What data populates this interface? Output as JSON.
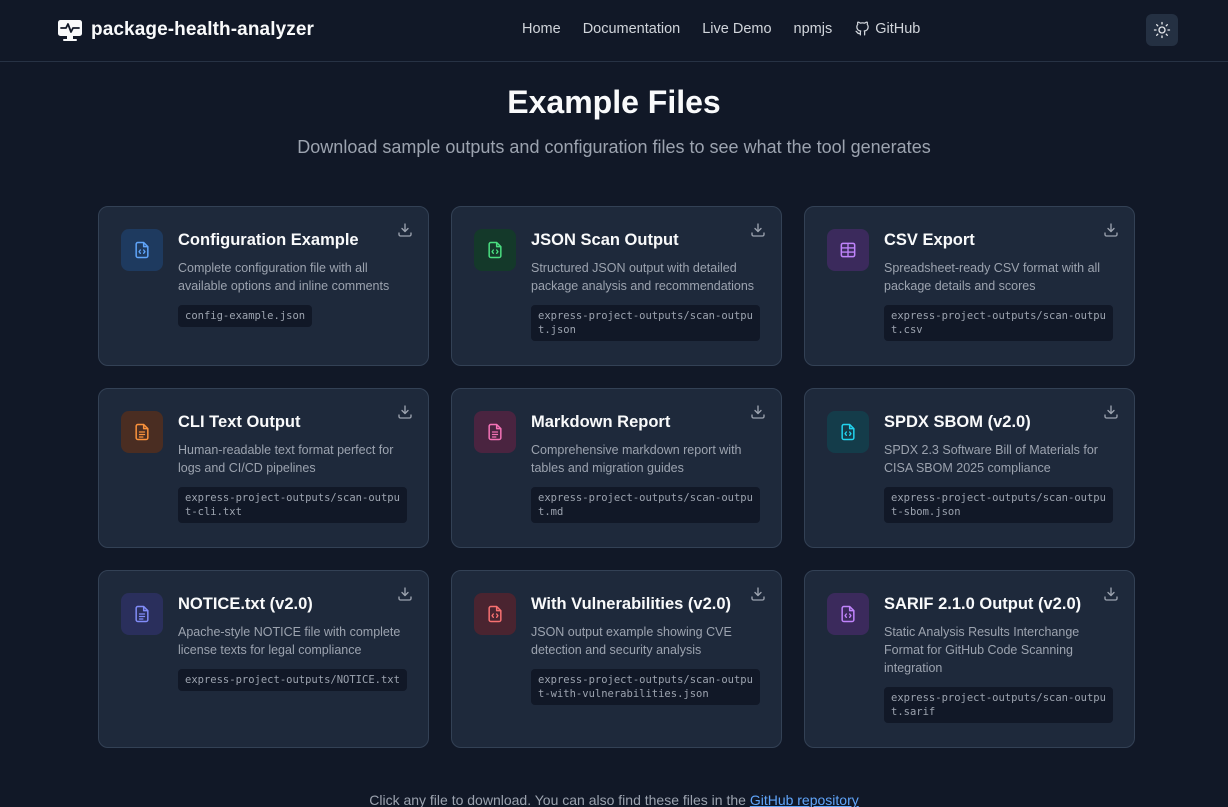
{
  "navbar": {
    "brand": "package-health-analyzer",
    "links": [
      {
        "label": "Home"
      },
      {
        "label": "Documentation"
      },
      {
        "label": "Live Demo"
      },
      {
        "label": "npmjs"
      },
      {
        "label": "GitHub",
        "icon": "github-icon"
      }
    ],
    "theme_toggle_icon": "sun-icon"
  },
  "page": {
    "title": "Example Files",
    "subtitle": "Download sample outputs and configuration files to see what the tool generates"
  },
  "cards": [
    {
      "title": "Configuration Example",
      "description": "Complete configuration file with all available options and inline comments",
      "path": "config-example.json",
      "icon": "file-code-icon",
      "accent": "#60a5fa",
      "accent_bg": "#1e3a5f"
    },
    {
      "title": "JSON Scan Output",
      "description": "Structured JSON output with detailed package analysis and recommendations",
      "path": "express-project-outputs/scan-output.json",
      "icon": "file-code-icon",
      "accent": "#4ade80",
      "accent_bg": "#14392a"
    },
    {
      "title": "CSV Export",
      "description": "Spreadsheet-ready CSV format with all package details and scores",
      "path": "express-project-outputs/scan-output.csv",
      "icon": "table-icon",
      "accent": "#c084fc",
      "accent_bg": "#3b2a5c"
    },
    {
      "title": "CLI Text Output",
      "description": "Human-readable text format perfect for logs and CI/CD pipelines",
      "path": "express-project-outputs/scan-output-cli.txt",
      "icon": "file-text-icon",
      "accent": "#fb923c",
      "accent_bg": "#4a2d22"
    },
    {
      "title": "Markdown Report",
      "description": "Comprehensive markdown report with tables and migration guides",
      "path": "express-project-outputs/scan-output.md",
      "icon": "file-text-icon",
      "accent": "#f472b6",
      "accent_bg": "#4a2440"
    },
    {
      "title": "SPDX SBOM (v2.0)",
      "description": "SPDX 2.3 Software Bill of Materials for CISA SBOM 2025 compliance",
      "path": "express-project-outputs/scan-output-sbom.json",
      "icon": "file-code-icon",
      "accent": "#22d3ee",
      "accent_bg": "#143c4a"
    },
    {
      "title": "NOTICE.txt (v2.0)",
      "description": "Apache-style NOTICE file with complete license texts for legal compliance",
      "path": "express-project-outputs/NOTICE.txt",
      "icon": "file-text-icon",
      "accent": "#818cf8",
      "accent_bg": "#2a2f5c"
    },
    {
      "title": "With Vulnerabilities (v2.0)",
      "description": "JSON output example showing CVE detection and security analysis",
      "path": "express-project-outputs/scan-output-with-vulnerabilities.json",
      "icon": "file-code-icon",
      "accent": "#f87171",
      "accent_bg": "#4a2430"
    },
    {
      "title": "SARIF 2.1.0 Output (v2.0)",
      "description": "Static Analysis Results Interchange Format for GitHub Code Scanning integration",
      "path": "express-project-outputs/scan-output.sarif",
      "icon": "file-code-icon",
      "accent": "#c084fc",
      "accent_bg": "#3b2a5c"
    }
  ],
  "footer": {
    "text": "Click any file to download. You can also find these files in the ",
    "link": "GitHub repository"
  }
}
